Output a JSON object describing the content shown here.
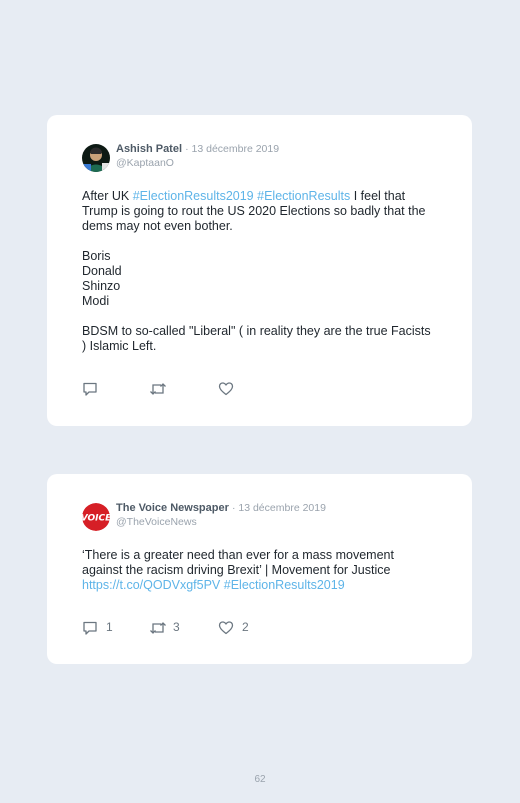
{
  "tweets": [
    {
      "name": "Ashish Patel",
      "date": "· 13 décembre 2019",
      "handle": "@KaptaanO",
      "line1_a": "After UK ",
      "line1_tag1": "#ElectionResults2019",
      "line1_sp": " ",
      "line1_tag2": "#ElectionResults",
      "line1_b": " I feel that Trump is going to rout the US 2020 Elections so badly that the dems may not even bother.",
      "list": [
        "Boris",
        "Donald",
        "Shinzo",
        "Modi"
      ],
      "closing": "BDSM to so-called \"Liberal\" ( in reality they are the true Facists ) Islamic Left."
    },
    {
      "name": "The Voice Newspaper",
      "date": "· 13 décembre 2019",
      "handle": "@TheVoiceNews",
      "text": "‘There is a greater need than ever for a mass movement against the racism driving Brexit’ | Movement for Justice",
      "link": "https://t.co/QODVxgf5PV",
      "sp": " ",
      "tag": "#ElectionResults2019",
      "avatar_text": "VOICE",
      "replies": "1",
      "retweets": "3",
      "likes": "2"
    }
  ],
  "page_number": "62",
  "colors": {
    "background": "#e7ecf3",
    "hashtag": "#5eb4e8",
    "voice_red": "#d61f26"
  }
}
